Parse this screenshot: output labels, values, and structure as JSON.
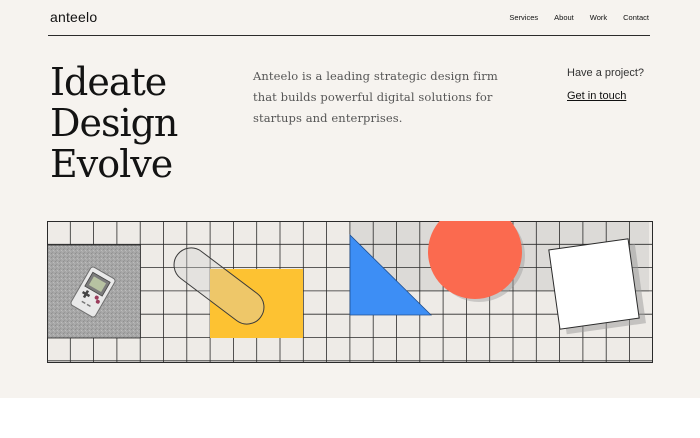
{
  "brand": {
    "logo": "anteelo"
  },
  "nav": {
    "items": [
      "Services",
      "About",
      "Work",
      "Contact"
    ]
  },
  "hero": {
    "lines": [
      "Ideate",
      "Design",
      "Evolve"
    ]
  },
  "intro": {
    "text": "Anteelo is a leading strategic design firm that builds powerful digital solutions for startups and enterprises."
  },
  "cta": {
    "question": "Have a project?",
    "link": "Get in touch"
  },
  "colors": {
    "background": "#f6f3ef",
    "yellow": "#fdc232",
    "blue": "#3d8ef5",
    "coral": "#fb6a4f",
    "grid_line": "#2a2a2a",
    "gray_panel": "#a9a9a9"
  },
  "illustration": {
    "icons": [
      "game-console-icon"
    ]
  }
}
